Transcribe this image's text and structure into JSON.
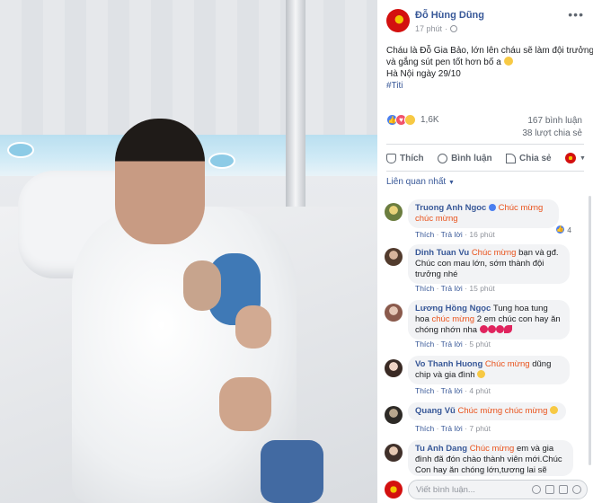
{
  "post": {
    "author": "Đỗ Hùng Dũng",
    "time": "17 phút",
    "caption_lines": [
      "Cháu là Đỗ Gia Bảo, lớn lên cháu sẽ làm đội trưởng",
      "và gắng sút pen tốt hơn bố a",
      "Hà Nội ngày 29/10"
    ],
    "hashtag": "#Titi",
    "reaction_count": "1,6K",
    "comment_count": "167 bình luận",
    "share_count": "38 lượt chia sẻ"
  },
  "actions": {
    "like": "Thích",
    "comment": "Bình luận",
    "share": "Chia sẻ"
  },
  "sort_label": "Liên quan nhất",
  "meta_labels": {
    "like": "Thích",
    "reply": "Trả lời"
  },
  "comments": [
    {
      "name": "Truong Anh Ngoc",
      "highlight": "Chúc mừng chúc mừng",
      "text": "",
      "time": "16 phút",
      "likes": "4"
    },
    {
      "name": "Dinh Tuan Vu",
      "highlight": "Chúc mừng",
      "text": "bạn và gđ. Chúc con mau lớn, sớm thành đội trưởng nhé",
      "time": "15 phút"
    },
    {
      "name": "Lương Hồng Ngọc",
      "highlight": "chúc mừng",
      "pre": "Tung hoa tung hoa",
      "text": "2 em chúc con hay ăn chóng nhớn nha",
      "time": "5 phút"
    },
    {
      "name": "Vo Thanh Huong",
      "highlight": "Chúc mừng",
      "text": "dũng chip và gia đình",
      "time": "4 phút"
    },
    {
      "name": "Quang Vũ",
      "highlight": "Chúc mừng chúc mừng",
      "text": "",
      "time": "7 phút"
    },
    {
      "name": "Tu Anh Dang",
      "highlight": "Chúc mừng",
      "text": "em và gia đình đã đón chào thành viên mới.Chúc Con hay ăn chóng lớn,tương lai sẽ Hùng Dũng mạnh",
      "time": ""
    }
  ],
  "composer": {
    "placeholder": "Viết bình luận..."
  },
  "colors": {
    "link": "#385898",
    "highlight": "#e9521b",
    "meta": "#90949c",
    "like": "#4a7ff0",
    "love": "#f2526b"
  }
}
